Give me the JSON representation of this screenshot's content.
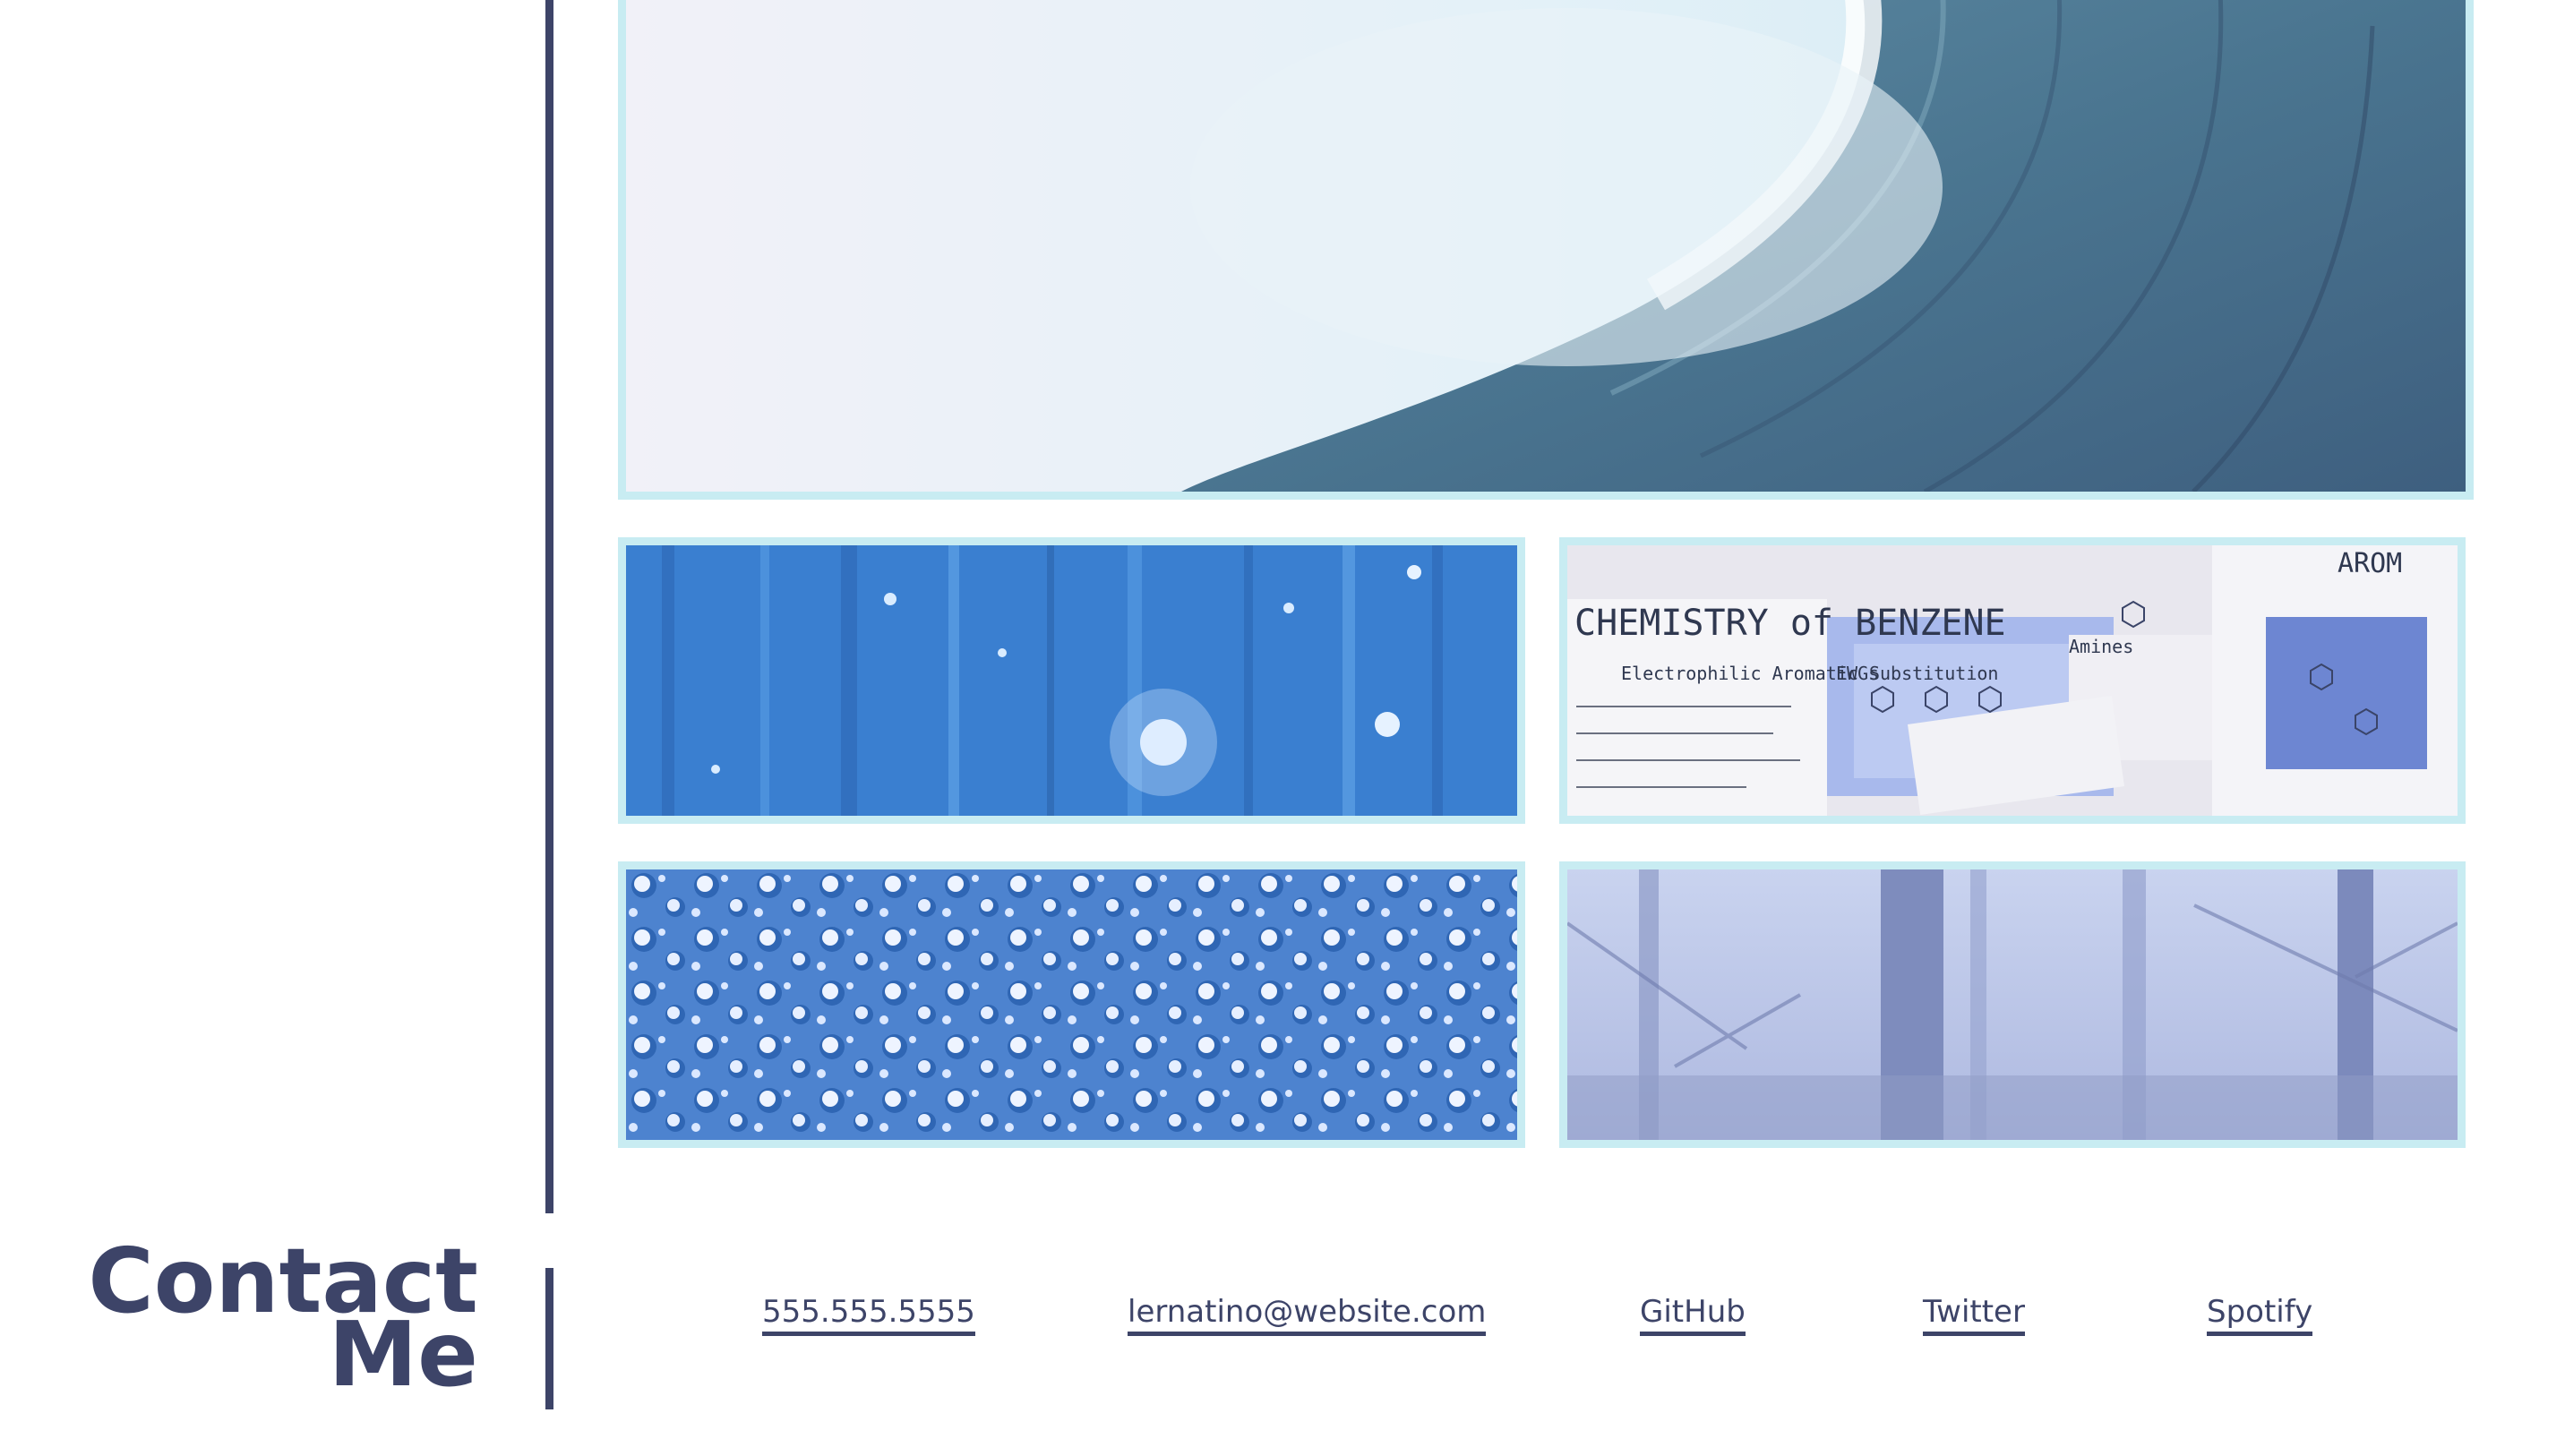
{
  "contact": {
    "title_line1": "Contact",
    "title_line2": "Me"
  },
  "links": {
    "phone": "555.555.5555",
    "email": "lernatino@website.com",
    "github": "GitHub",
    "twitter": "Twitter",
    "spotify": "Spotify"
  },
  "gallery": {
    "images": [
      {
        "subject": "ocean wave"
      },
      {
        "subject": "blue digital light streams"
      },
      {
        "subject": "chemistry notes"
      },
      {
        "subject": "water droplets"
      },
      {
        "subject": "misty forest"
      }
    ],
    "notes": {
      "heading": "CHEMISTRY of BENZENE",
      "subheading": "Electrophilic Aromatic Substitution",
      "tag_ewg": "EWGs",
      "tag_amines": "Amines",
      "corner": "AROM"
    }
  },
  "colors": {
    "accent": "#3d4468",
    "frame": "#c8ecf2",
    "background": "#ffffff"
  }
}
